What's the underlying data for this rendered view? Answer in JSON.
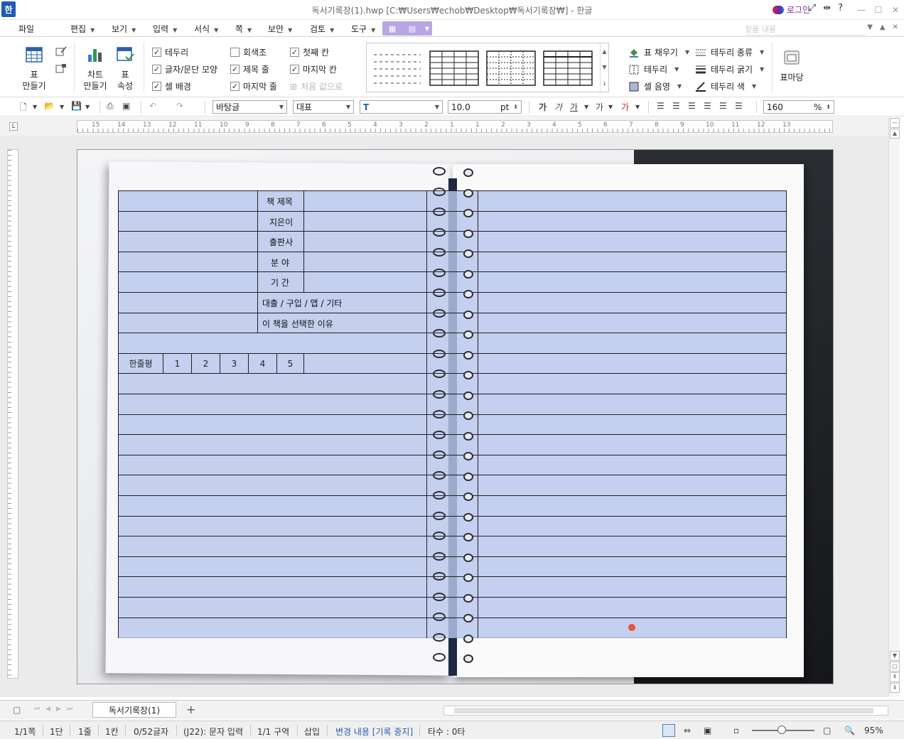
{
  "window": {
    "app_logo": "한",
    "title": "독서기록장(1).hwp [C:₩Users₩echob₩Desktop₩독서기록장₩] - 한글",
    "login": "로그인",
    "help": "?"
  },
  "menu": {
    "items": [
      "파일",
      "편집",
      "보기",
      "입력",
      "서식",
      "쪽",
      "보안",
      "검토",
      "도구"
    ],
    "search_placeholder": "찾을 내용"
  },
  "ribbon": {
    "table_make": [
      "표",
      "만들기"
    ],
    "chart_make": [
      "차트",
      "만들기"
    ],
    "table_props": [
      "표",
      "속성"
    ],
    "checks": [
      {
        "label": "테두리",
        "checked": true
      },
      {
        "label": "글자/문단 모양",
        "checked": true
      },
      {
        "label": "셀 배경",
        "checked": true
      },
      {
        "label": "회색조",
        "checked": false
      },
      {
        "label": "제목 줄",
        "checked": true
      },
      {
        "label": "마지막 줄",
        "checked": true
      },
      {
        "label": "첫째 칸",
        "checked": true
      },
      {
        "label": "마지막 칸",
        "checked": true
      },
      {
        "label": "처음 값으로",
        "checked": false,
        "disabled": true
      }
    ],
    "fill": "표 채우기",
    "border": "테두리",
    "cell_shade": "셀 음영",
    "border_type": "테두리 종류",
    "border_width": "테두리 굵기",
    "border_color": "테두리 색",
    "table_bookmark": "표마당"
  },
  "toolbar": {
    "style": "바탕글",
    "font_lang": "대표",
    "font_name": "",
    "font_size": "10.0",
    "font_unit": "pt",
    "format_buttons": [
      "가",
      "가",
      "가",
      "가",
      "가"
    ],
    "line_spacing": "160",
    "line_spacing_unit": "%"
  },
  "ruler": {
    "numbers": [
      "15",
      "14",
      "13",
      "12",
      "11",
      "10",
      "9",
      "8",
      "7",
      "6",
      "5",
      "4",
      "3",
      "2",
      "1",
      "1",
      "2",
      "3",
      "4",
      "5",
      "6",
      "7",
      "8",
      "9",
      "10",
      "11",
      "12",
      "13"
    ]
  },
  "document": {
    "labels": {
      "title": "책 제목",
      "author": "지은이",
      "publisher": "출판사",
      "genre": "분 야",
      "period": "기 간",
      "source": "대출 / 구입 / 앱 / 기타",
      "reason": "이 책을 선택한 이유",
      "review": "한줄평"
    },
    "ratings": [
      "1",
      "2",
      "3",
      "4",
      "5"
    ]
  },
  "tabs": {
    "doc_tab": "독서기록장(1)",
    "add": "+"
  },
  "status": {
    "page": "1/1쪽",
    "section_col": "1단",
    "line": "1줄",
    "col": "1칸",
    "chars": "0/52글자",
    "cell_mode": "(J22): 문자 입력",
    "zone": "1/1 구역",
    "insert": "삽입",
    "track": "변경 내용 [기록 중지]",
    "typing": "타수 : 0타",
    "zoom": "95%"
  },
  "colors": {
    "accent": "#1e5bb5",
    "table_fill": "#bac6ec",
    "mode_button": "#b7a6e3",
    "marker_dot": "#e8553d"
  }
}
